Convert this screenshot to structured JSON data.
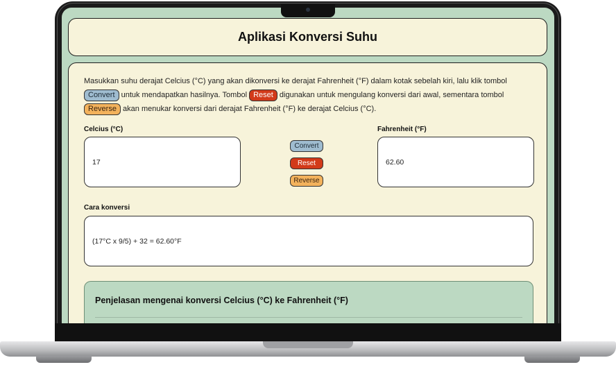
{
  "app": {
    "title": "Aplikasi Konversi Suhu"
  },
  "intro": {
    "part1": "Masukkan suhu derajat Celcius (°C) yang akan dikonversi ke derajat Fahrenheit (°F) dalam kotak sebelah kiri, lalu klik tombol",
    "convert_pill": "Convert",
    "part2": "untuk mendapatkan hasilnya. Tombol",
    "reset_pill": "Reset",
    "part3": "digunakan untuk mengulang konversi dari awal, sementara tombol",
    "reverse_pill": "Reverse",
    "part4": "akan menukar konversi dari derajat Fahrenheit (°F) ke derajat Celcius (°C)."
  },
  "celcius": {
    "label": "Celcius (°C)",
    "value": "17"
  },
  "fahrenheit": {
    "label": "Fahrenheit (°F)",
    "value": "62.60"
  },
  "buttons": {
    "convert": "Convert",
    "reset": "Reset",
    "reverse": "Reverse"
  },
  "method": {
    "label": "Cara konversi",
    "value": "(17°C x 9/5) + 32 = 62.60°F"
  },
  "explanation": {
    "title": "Penjelasan mengenai konversi Celcius (°C) ke Fahrenheit (°F)"
  },
  "colors": {
    "screen_bg": "#bcd9c2",
    "card_bg": "#f7f3da",
    "convert": "#9fbcd0",
    "reset": "#d23a1a",
    "reverse": "#f3b25c"
  }
}
